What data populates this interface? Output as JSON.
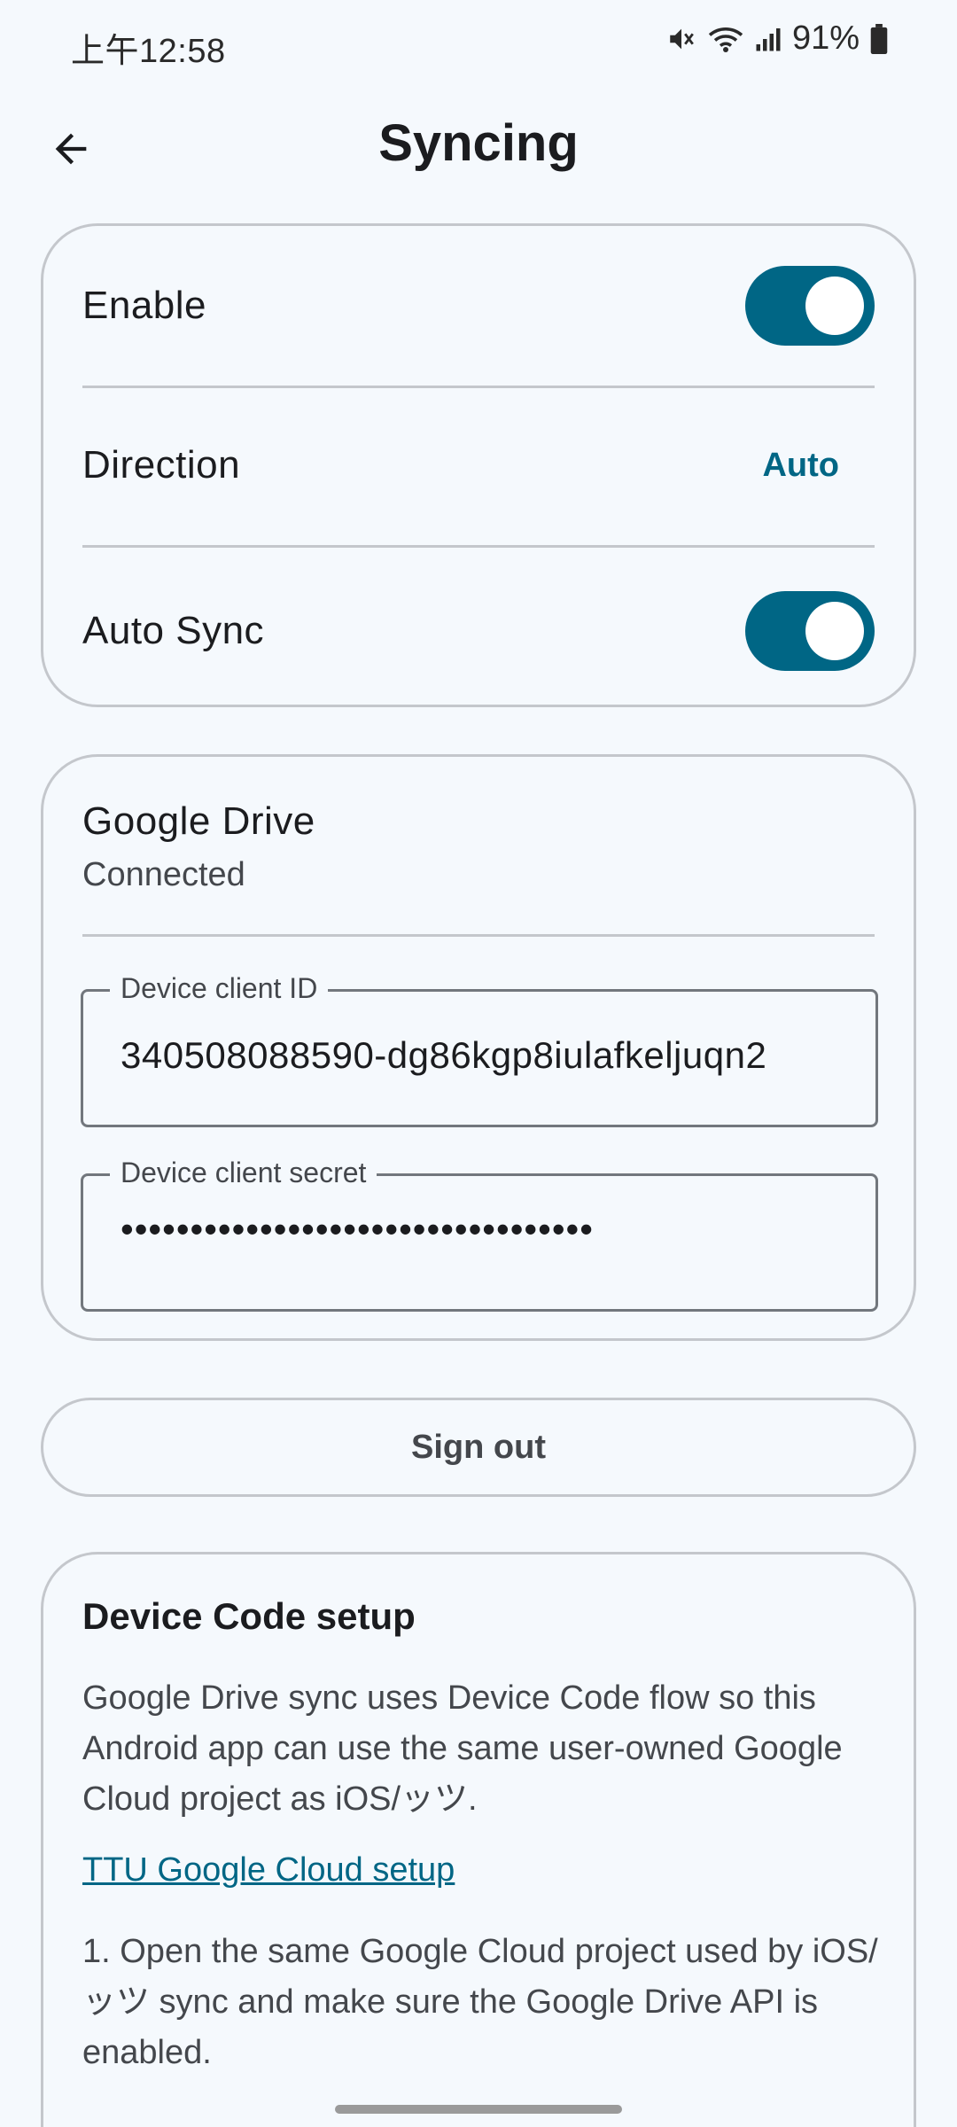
{
  "status_bar": {
    "time": "上午12:58",
    "battery": "91%"
  },
  "app_bar": {
    "title": "Syncing"
  },
  "settings": {
    "enable_label": "Enable",
    "enable_on": true,
    "direction_label": "Direction",
    "direction_value": "Auto",
    "auto_sync_label": "Auto Sync",
    "auto_sync_on": true
  },
  "drive": {
    "title": "Google Drive",
    "status": "Connected",
    "client_id_label": "Device client ID",
    "client_id_value": "340508088590-dg86kgp8iulafkeljuqn2",
    "client_secret_label": "Device client secret",
    "client_secret_value": "••••••••••••••••••••••••••••••••••"
  },
  "sign_out_label": "Sign out",
  "setup": {
    "title": "Device Code setup",
    "description": "Google Drive sync uses Device Code flow so this Android app can use the same user-owned Google Cloud project as iOS/ッツ.",
    "link_text": "TTU Google Cloud setup",
    "step1": "1. Open the same Google Cloud project used by iOS/ッツ sync and make sure the Google Drive API is enabled."
  },
  "colors": {
    "accent": "#006685",
    "background": "#f5f9fd",
    "outline": "#c4c7cc"
  }
}
